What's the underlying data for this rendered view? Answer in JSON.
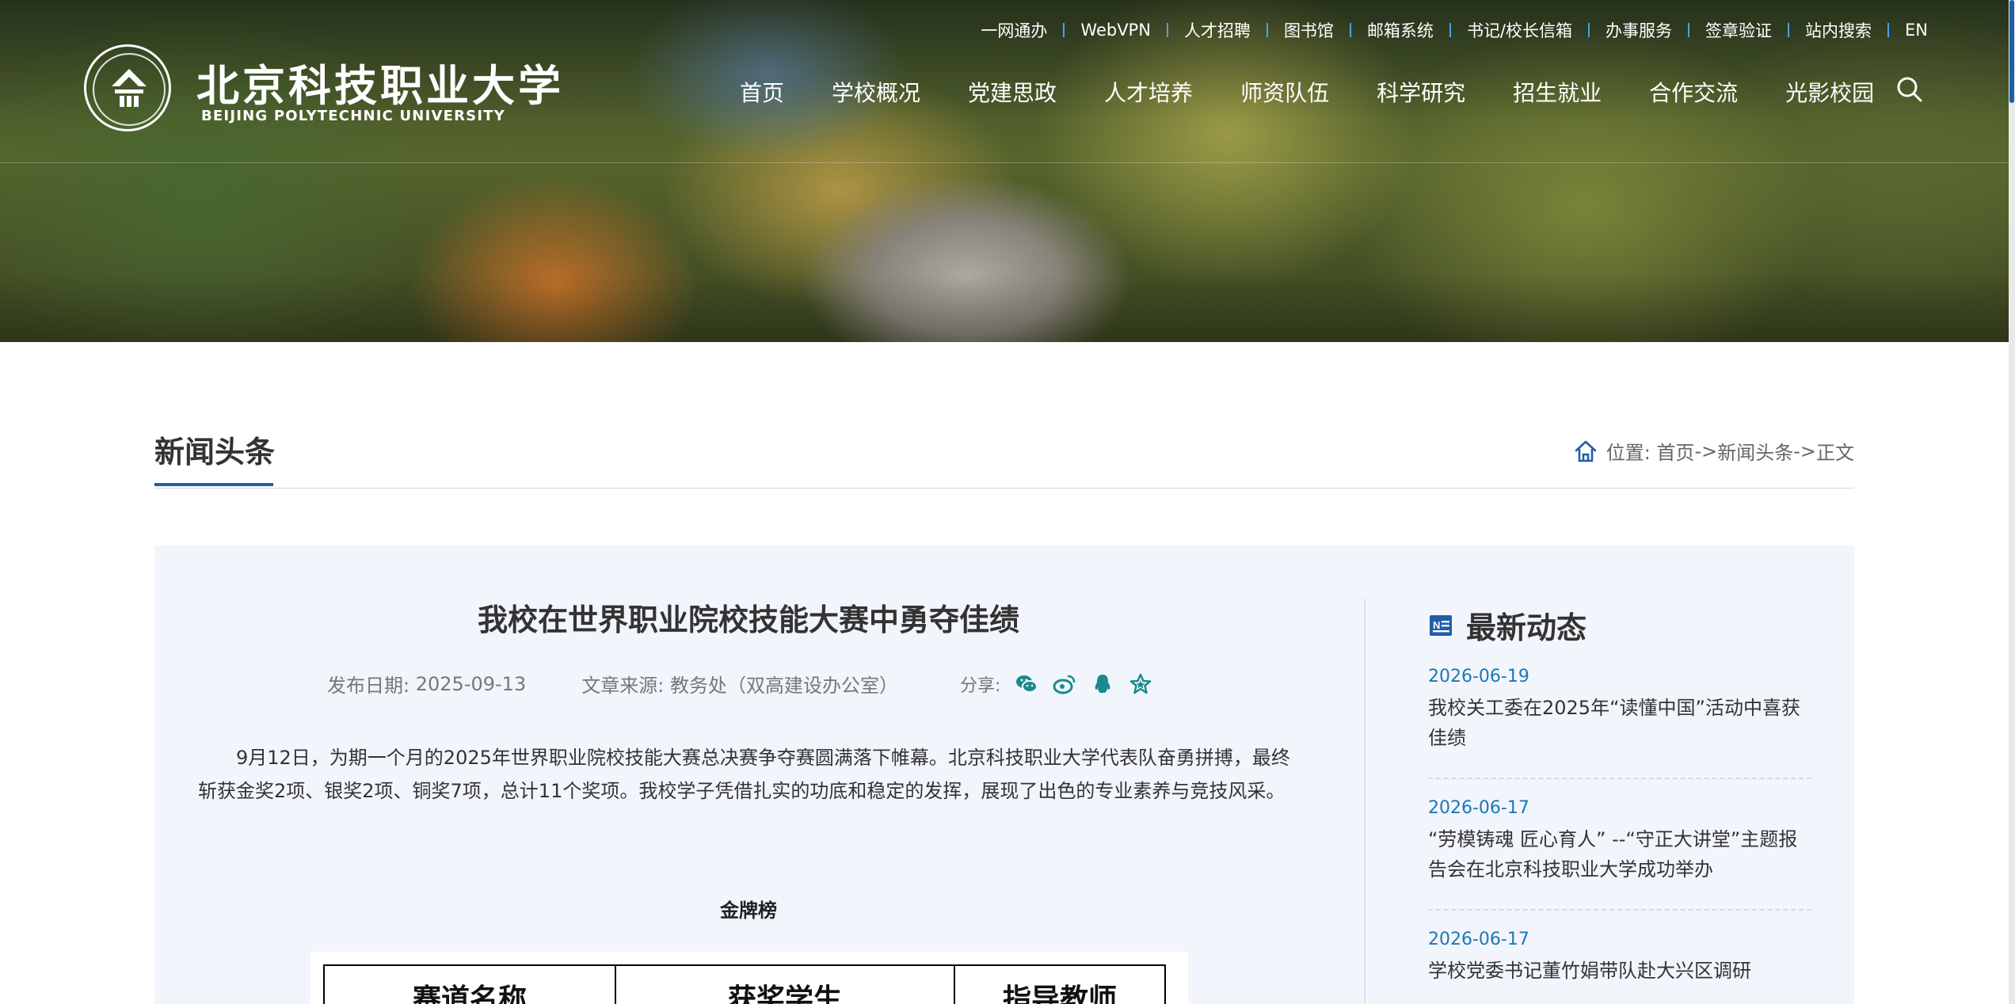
{
  "header": {
    "logo_cn": "北京科技职业大学",
    "logo_en": "BEIJING POLYTECHNIC UNIVERSITY",
    "top_links": [
      "一网通办",
      "WebVPN",
      "人才招聘",
      "图书馆",
      "邮箱系统",
      "书记/校长信箱",
      "办事服务",
      "签章验证",
      "站内搜索",
      "EN"
    ],
    "nav": [
      "首页",
      "学校概况",
      "党建思政",
      "人才培养",
      "师资队伍",
      "科学研究",
      "招生就业",
      "合作交流",
      "光影校园"
    ]
  },
  "section": {
    "title": "新闻头条",
    "breadcrumb": {
      "label": "位置:",
      "items": [
        "首页",
        "新闻头条",
        "正文"
      ],
      "separator": "->"
    }
  },
  "article": {
    "title": "我校在世界职业院校技能大赛中勇夺佳绩",
    "date_label": "发布日期:",
    "date": "2025-09-13",
    "source_label": "文章来源:",
    "source": "教务处（双高建设办公室）",
    "share_label": "分享:",
    "share_icons": [
      "wechat-icon",
      "weibo-icon",
      "qq-icon",
      "favorite-star-icon"
    ],
    "body": "9月12日，为期一个月的2025年世界职业院校技能大赛总决赛争夺赛圆满落下帷幕。北京科技职业大学代表队奋勇拼搏，最终斩获金奖2项、银奖2项、铜奖7项，总计11个奖项。我校学子凭借扎实的功底和稳定的发挥，展现了出色的专业素养与竞技风采。",
    "table_caption": "金牌榜",
    "table_headers": [
      "赛道名称",
      "获奖学生",
      "指导教师"
    ]
  },
  "sidebar": {
    "title": "最新动态",
    "items": [
      {
        "date": "2026-06-19",
        "text": "我校关工委在2025年“读懂中国”活动中喜获佳绩"
      },
      {
        "date": "2026-06-17",
        "text": "“劳模铸魂 匠心育人” --“守正大讲堂”主题报告会在北京科技职业大学成功举办"
      },
      {
        "date": "2026-06-17",
        "text": "学校党委书记董竹娟带队赴大兴区调研"
      }
    ]
  },
  "colors": {
    "accent": "#1f5ea8",
    "date_blue": "#1a78b6",
    "share_teal": "#1a8a8e",
    "panel_bg": "#f2f6fc"
  }
}
